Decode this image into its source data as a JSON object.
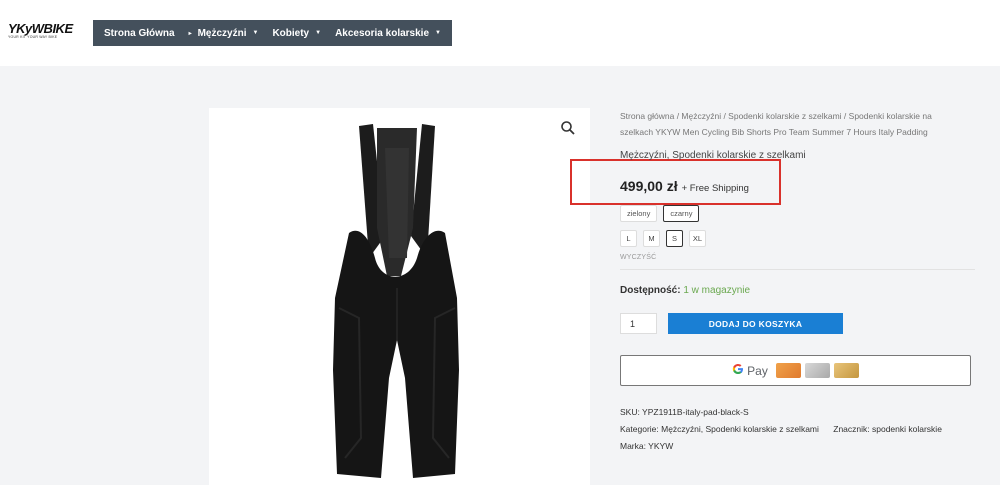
{
  "header": {
    "logo_text": "YKyWBIKE",
    "logo_tagline": "YOUR KIT YOUR WAY BIKE",
    "nav": [
      {
        "label": "Strona Główna"
      },
      {
        "label": "Mężczyźni"
      },
      {
        "label": "Kobiety"
      },
      {
        "label": "Akcesoria kolarskie"
      }
    ]
  },
  "product": {
    "breadcrumb": "Strona główna / Mężczyźni / Spodenki kolarskie z szelkami / Spodenki kolarskie na szelkach YKYW Men Cycling Bib Shorts Pro Team Summer 7 Hours Italy Padding",
    "categories_line": "Mężczyźni, Spodenki kolarskie z szelkami",
    "price": "499,00 zł",
    "shipping": "+ Free Shipping",
    "colors": [
      {
        "label": "zielony",
        "selected": false
      },
      {
        "label": "czarny",
        "selected": true
      }
    ],
    "sizes": [
      {
        "label": "L",
        "selected": false
      },
      {
        "label": "M",
        "selected": false
      },
      {
        "label": "S",
        "selected": true
      },
      {
        "label": "XL",
        "selected": false
      }
    ],
    "reset_label": "WYCZYŚĆ",
    "availability_label": "Dostępność:",
    "availability_value": "1 w magazynie",
    "quantity": "1",
    "add_to_cart": "DODAJ DO KOSZYKA",
    "gpay_label": "Pay",
    "sku_line": "SKU: YPZ1911B-italy-pad-black-S",
    "categories_meta": "Kategorie: Mężczyźni, Spodenki kolarskie z szelkami",
    "tag_meta": "Znacznik: spodenki kolarskie",
    "brand_meta": "Marka: YKYW"
  },
  "colors": {
    "nav_bg": "#44505c",
    "button_blue": "#1a7fd4",
    "highlight_red": "#d9312b",
    "instock_green": "#6aa84f"
  }
}
